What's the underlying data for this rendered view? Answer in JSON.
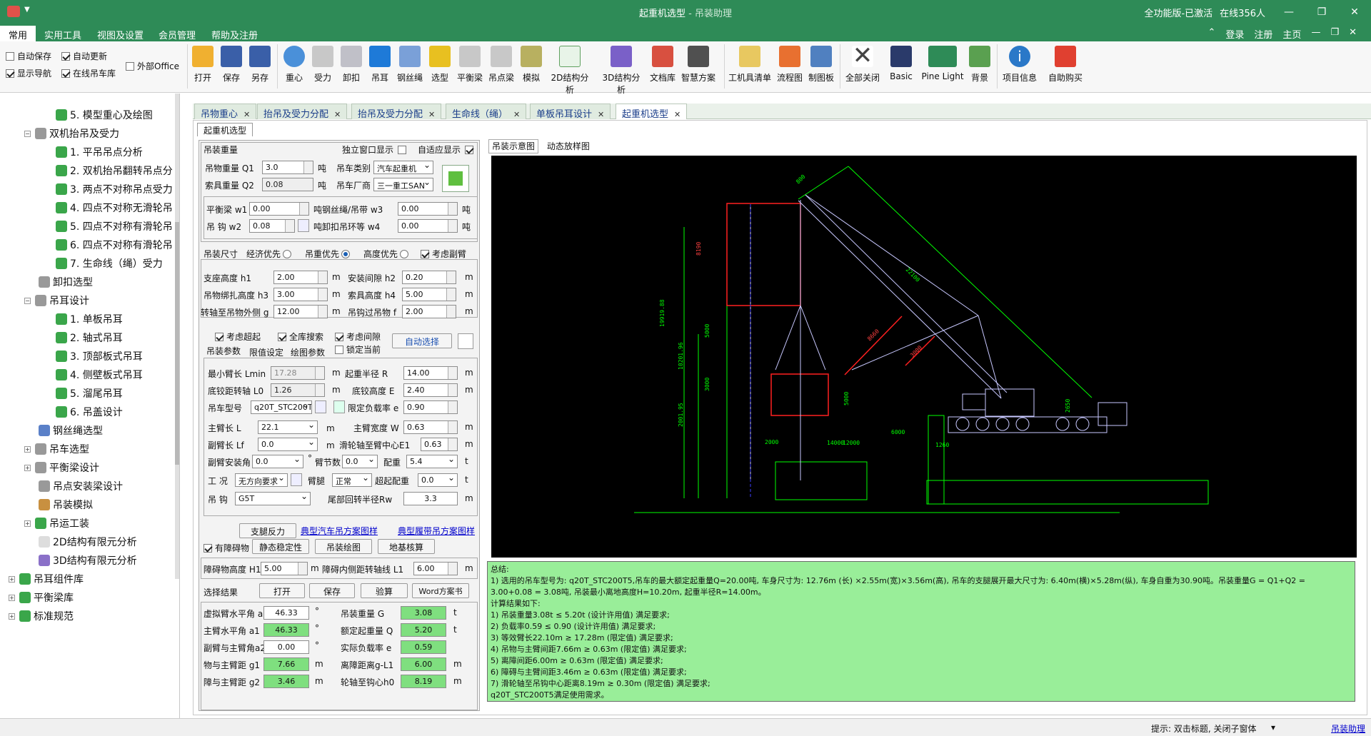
{
  "window": {
    "title": "起重机选型",
    "subtitle": " - 吊装助理",
    "edition": "全功能版-已激活",
    "online": "在线356人"
  },
  "menu": {
    "items": [
      "常用",
      "实用工具",
      "视图及设置",
      "会员管理",
      "帮助及注册"
    ],
    "right": [
      "登录",
      "注册",
      "主页"
    ]
  },
  "ribbon": {
    "checks": [
      {
        "label": "自动保存",
        "on": false
      },
      {
        "label": "自动更新",
        "on": true
      },
      {
        "label": "显示导航",
        "on": true
      },
      {
        "label": "在线吊车库",
        "on": true
      },
      {
        "label": "外部Office",
        "on": false
      }
    ],
    "buttons": [
      "打开",
      "保存",
      "另存",
      "重心",
      "受力",
      "卸扣",
      "吊耳",
      "钢丝绳",
      "选型",
      "平衡梁",
      "吊点梁",
      "模拟",
      "2D结构分析",
      "3D结构分析",
      "文档库",
      "智慧方案",
      "工机具清单",
      "流程图",
      "制图板",
      "全部关闭",
      "Basic",
      "Pine Light",
      "背景",
      "项目信息",
      "自助购买"
    ]
  },
  "sidebar": {
    "items": [
      {
        "label": "5. 模型重心及绘图",
        "lvl": 2
      },
      {
        "label": "双机抬吊及受力",
        "lvl": 1
      },
      {
        "label": "1. 平吊吊点分析",
        "lvl": 2
      },
      {
        "label": "2. 双机抬吊翻转吊点分",
        "lvl": 2
      },
      {
        "label": "3. 两点不对称吊点受力",
        "lvl": 2
      },
      {
        "label": "4. 四点不对称无滑轮吊",
        "lvl": 2
      },
      {
        "label": "5. 四点不对称有滑轮吊",
        "lvl": 2
      },
      {
        "label": "6. 四点不对称有滑轮吊",
        "lvl": 2
      },
      {
        "label": "7. 生命线（绳）受力",
        "lvl": 2
      },
      {
        "label": "卸扣选型",
        "lvl": 1
      },
      {
        "label": "吊耳设计",
        "lvl": 1
      },
      {
        "label": "1. 单板吊耳",
        "lvl": 2
      },
      {
        "label": "2. 轴式吊耳",
        "lvl": 2
      },
      {
        "label": "3. 顶部板式吊耳",
        "lvl": 2
      },
      {
        "label": "4. 侧壁板式吊耳",
        "lvl": 2
      },
      {
        "label": "5. 溜尾吊耳",
        "lvl": 2
      },
      {
        "label": "6. 吊盖设计",
        "lvl": 2
      },
      {
        "label": "钢丝绳选型",
        "lvl": 1
      },
      {
        "label": "吊车选型",
        "lvl": 1
      },
      {
        "label": "平衡梁设计",
        "lvl": 1
      },
      {
        "label": "吊点安装梁设计",
        "lvl": 1
      },
      {
        "label": "吊装模拟",
        "lvl": 1
      },
      {
        "label": "吊运工装",
        "lvl": 1
      },
      {
        "label": "2D结构有限元分析",
        "lvl": 1
      },
      {
        "label": "3D结构有限元分析",
        "lvl": 1
      },
      {
        "label": "吊耳组件库",
        "lvl": 0
      },
      {
        "label": "平衡梁库",
        "lvl": 0
      },
      {
        "label": "标准规范",
        "lvl": 0
      }
    ]
  },
  "tabs": [
    "吊物重心",
    "抬吊及受力分配",
    "抬吊及受力分配",
    "生命线（绳）",
    "单板吊耳设计",
    "起重机选型"
  ],
  "subtab": "起重机选型",
  "form": {
    "g1_title": "吊装重量",
    "indep": "独立窗口显示",
    "adapt": "自适应显示",
    "q1_lbl": "吊物重量 Q1",
    "q1_val": "3.0",
    "ton": "吨",
    "crane_type_lbl": "吊车类别",
    "crane_type": "汽车起重机",
    "q2_lbl": "索具重量 Q2",
    "q2_val": "0.08",
    "maker_lbl": "吊车厂商",
    "maker": "三一重工SAN",
    "w1_lbl": "平衡梁 w1",
    "w1_val": "0.00",
    "w3_lbl": "钢丝绳/吊带 w3",
    "w3_val": "0.00",
    "w2_lbl": "吊 钩 w2",
    "w2_val": "0.08",
    "w4_lbl": "卸扣吊环等 w4",
    "w4_val": "0.00",
    "size_lbl": "吊装尺寸",
    "opt1": "经济优先",
    "opt2": "吊重优先",
    "opt3": "高度优先",
    "opt4": "考虑副臂",
    "h1_lbl": "支座高度 h1",
    "h1_val": "2.00",
    "m": "m",
    "h2_lbl": "安装间隙 h2",
    "h2_val": "0.20",
    "h3_lbl": "吊物绑扎高度 h3",
    "h3_val": "3.00",
    "h4_lbl": "索具高度 h4",
    "h4_val": "5.00",
    "g_lbl": "转轴至吊物外侧 g",
    "g_val": "12.00",
    "f_lbl": "吊钩过吊物 f",
    "f_val": "2.00",
    "c1": "考虑超起",
    "c2": "全库搜索",
    "c3": "考虑间隙",
    "c4": "锁定当前",
    "auto": "自动选择",
    "t1": "吊装参数",
    "t2": "限值设定",
    "t3": "绘图参数",
    "lmin_lbl": "最小臂长 Lmin",
    "lmin_val": "17.28",
    "r_lbl": "起重半径 R",
    "r_val": "14.00",
    "l0_lbl": "底铰距转轴 L0",
    "l0_val": "1.26",
    "e_lbl": "底铰高度 E",
    "e_val": "2.40",
    "model_lbl": "吊车型号",
    "model": "q20T_STC200T",
    "rate_lbl": "限定负载率 e",
    "rate_val": "0.90",
    "l_lbl": "主臂长 L",
    "l_val": "22.1",
    "w_lbl": "主臂宽度 W",
    "w_val": "0.63",
    "lf_lbl": "副臂长 Lf",
    "lf_val": "0.0",
    "e1_lbl": "滑轮轴至臂中心E1",
    "e1_val": "0.63",
    "ang_lbl": "副臂安装角",
    "ang_val": "0.0",
    "deg": "°",
    "sec_lbl": "臂节数",
    "sec_val": "0.0",
    "cw_lbl": "配重",
    "cw_val": "5.4",
    "t": "t",
    "cond_lbl": "工 况",
    "cond": "无方向要求",
    "leg_lbl": "臂腿",
    "leg": "正常",
    "super_lbl": "超起配重",
    "super_val": "0.0",
    "hook_lbl": "吊 钩",
    "hook": "G5T",
    "tail_lbl": "尾部回转半径Rw",
    "tail_val": "3.3",
    "b1": "支腿反力",
    "b2": "静态稳定性",
    "b3": "吊装绘图",
    "b4": "地基核算",
    "l1": "典型汽车吊方案图样",
    "l2": "典型履带吊方案图样",
    "obs": "有障碍物",
    "obs_h_lbl": "障碍物高度 H1",
    "obs_h_val": "5.00",
    "obs_l_lbl": "障碍内侧距转轴线 L1",
    "obs_l_val": "6.00",
    "sel": "选择结果",
    "s1": "打开",
    "s2": "保存",
    "s3": "验算",
    "s4": "Word方案书",
    "r1a": "虚拟臂水平角 a",
    "r1a_v": "46.33",
    "r1b": "吊装重量 G",
    "r1b_v": "3.08",
    "r2a": "主臂水平角 a1",
    "r2a_v": "46.33",
    "r2b": "额定起重量 Q",
    "r2b_v": "5.20",
    "r3a": "副臂与主臂角a2",
    "r3a_v": "0.00",
    "r3b": "实际负载率 e",
    "r3b_v": "0.59",
    "r4a": "物与主臂距 g1",
    "r4a_v": "7.66",
    "r4b": "离障距离g-L1",
    "r4b_v": "6.00",
    "r5a": "障与主臂距 g2",
    "r5a_v": "3.46",
    "r5b": "轮轴至钩心h0",
    "r5b_v": "8.19"
  },
  "drawing": {
    "tab1": "吊装示意图",
    "tab2": "动态放样图",
    "labels": [
      "22100",
      "19919.88",
      "5000",
      "10201.96",
      "3000",
      "2001.95",
      "2000",
      "14000",
      "12000",
      "6000",
      "1260",
      "2650",
      "5000",
      "8190",
      "8660",
      "3000",
      "800"
    ]
  },
  "summary": {
    "lines": [
      "总结:",
      "  1) 选用的吊车型号为: q20T_STC200T5,吊车的最大额定起重量Q=20.00吨, 车身尺寸为: 12.76m (长) ×2.55m(宽)×3.56m(高), 吊车的支腿展开最大尺寸为: 6.40m(横)×5.28m(纵), 车身自重为30.90吨。吊装重量G = Q1+Q2 =",
      "3.00+0.08 = 3.08吨, 吊装最小离地高度H=10.20m, 起重半径R=14.00m。",
      "  计算结果如下:",
      "    1) 吊装重量3.08t ≤ 5.20t (设计许用值) 满足要求;",
      "    2) 负载率0.59 ≤ 0.90 (设计许用值) 满足要求;",
      "    3) 等效臂长22.10m ≥ 17.28m (限定值) 满足要求;",
      "    4) 吊物与主臂间距7.66m ≥ 0.63m (限定值) 满足要求;",
      "    5) 离障间距6.00m ≥ 0.63m (限定值) 满足要求;",
      "    6) 障碍与主臂间距3.46m ≥ 0.63m (限定值) 满足要求;",
      "    7) 滑轮轴至吊钩中心距离8.19m ≥ 0.30m (限定值) 满足要求;",
      "  q20T_STC200T5满足使用需求。"
    ]
  },
  "status": {
    "hint": "提示: 双击标题, 关闭子窗体",
    "link": "吊装助理"
  }
}
